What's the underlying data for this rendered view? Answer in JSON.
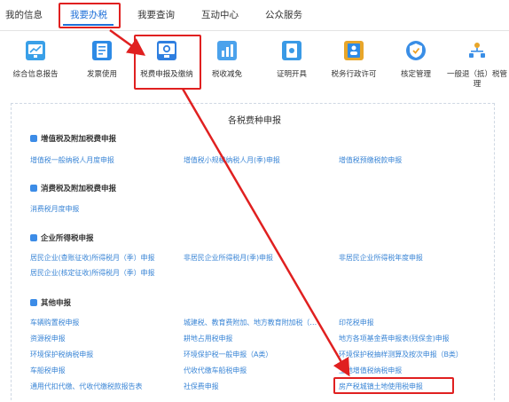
{
  "nav": {
    "items": [
      "我的信息",
      "我要办税",
      "我要查询",
      "互动中心",
      "公众服务"
    ],
    "active_index": 1,
    "accent_color": "#1e6fd8"
  },
  "functions": [
    {
      "label": "综合信息报告",
      "icon": "monitor-chart-icon",
      "color": "#3aa0e8"
    },
    {
      "label": "发票使用",
      "icon": "invoice-document-icon",
      "color": "#2e8be6"
    },
    {
      "label": "税费申报及缴纳",
      "icon": "monitor-gear-icon",
      "color": "#2f7fe0"
    },
    {
      "label": "税收减免",
      "icon": "bar-chart-icon",
      "color": "#4ba2ec"
    },
    {
      "label": "证明开具",
      "icon": "certificate-icon",
      "color": "#3a9ae6"
    },
    {
      "label": "税务行政许可",
      "icon": "person-id-icon",
      "color": "#e8a62a"
    },
    {
      "label": "核定管理",
      "icon": "shield-check-icon",
      "color": "#3a8ee6"
    },
    {
      "label": "一般退（抵）税管理",
      "icon": "org-chart-icon",
      "color": "#e8a62a"
    }
  ],
  "panel": {
    "title": "各税费种申报",
    "sections": [
      {
        "title": "增值税及附加税费申报",
        "links": [
          "增值税一般纳税人月度申报",
          "增值税小规模纳税人月(季)申报",
          "增值税预缴税款申报"
        ]
      },
      {
        "title": "消费税及附加税费申报",
        "links": [
          "消费税月度申报"
        ]
      },
      {
        "title": "企业所得税申报",
        "links": [
          "居民企业(查账征收)所得税月（季）申报",
          "非居民企业所得税月(季)申报",
          "非居民企业所得税年度申报",
          "居民企业(核定征收)所得税月（季）申报"
        ]
      },
      {
        "title": "其他申报",
        "links": [
          "车辆购置税申报",
          "城建税、教育费附加、地方教育附加税（…",
          "印花税申报",
          "资源税申报",
          "耕地占用税申报",
          "地方各项基金费申报表(残保金)申报",
          "环境保护税纳税申报",
          "环境保护税一般申报（A类）",
          "环境保护税抽样测算及按次申报（B类）",
          "车船税申报",
          "代收代缴车船税申报",
          "土地增值税纳税申报",
          "通用代扣代缴、代收代缴税款报告表",
          "社保费申报",
          "房产税城镇土地使用税申报"
        ]
      }
    ]
  },
  "highlight_color": "#e02020"
}
